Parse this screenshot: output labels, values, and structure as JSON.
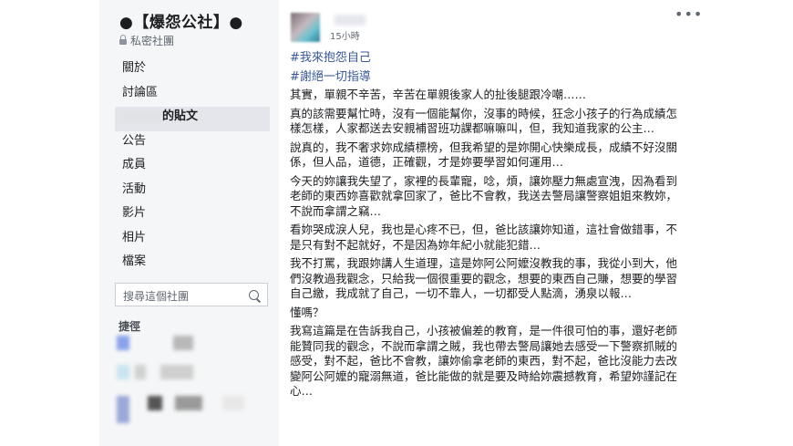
{
  "group": {
    "title": "●【爆怨公社】●",
    "privacy": "私密社團"
  },
  "nav": {
    "items": [
      {
        "label": "關於"
      },
      {
        "label": "討論區"
      },
      {
        "label": "的貼文"
      },
      {
        "label": "公告"
      },
      {
        "label": "成員"
      },
      {
        "label": "活動"
      },
      {
        "label": "影片"
      },
      {
        "label": "相片"
      },
      {
        "label": "檔案"
      }
    ],
    "active_index": 2
  },
  "search": {
    "placeholder": "搜尋這個社團"
  },
  "shortcuts": {
    "label": "捷徑"
  },
  "post": {
    "time": "15小時",
    "more": "•••",
    "hashtags": [
      "#我來抱怨自己",
      "#謝絕一切指導"
    ],
    "paragraphs": [
      "其實，單親不辛苦，辛苦在單親後家人的扯後腿跟冷嘲……",
      "真的該需要幫忙時，沒有一個能幫你，沒事的時候，狂念小孩子的行為成績怎樣怎樣，人家都送去安親補習班功課都嘛嘛叫，但，我知道我家的公主…",
      "說真的，我不奢求妳成績標榜，但我希望的是妳開心快樂成長，成績不好沒關係，但人品，道德，正確觀，才是妳要學習如何運用…",
      "今天的妳讓我失望了，家裡的長輩寵，唸，煩，讓妳壓力無處宣洩，因為看到老師的東西妳喜歡就拿回家了，爸比不會教，我送去警局讓警察姐姐來教妳，不說而拿謂之竊…",
      "看妳哭成淚人兒，我也是心疼不已，但，爸比該讓妳知道，這社會做錯事，不是只有對不起就好，不是因為妳年紀小就能犯錯…",
      "我不打罵，我跟妳講人生道理，這是妳阿公阿嬤沒教我的事，我從小到大，他們沒教過我觀念，只給我一個很重要的觀念，想要的東西自己賺，想要的學習自己繳，我成就了自己，一切不靠人，一切都受人點滴，湧泉以報…",
      "懂嗎？",
      "我寫這篇是在告訴我自己，小孩被偏差的教育，是一件很可怕的事，還好老師能贊同我的觀念，不說而拿謂之賊，我也帶去警局讓她去感受一下警察抓賊的感受，對不起，爸比不會教，讓妳偷拿老師的東西，對不起，爸比沒能力去改變阿公阿嬤的寵溺無道，爸比能做的就是要及時給妳震撼教育，希望妳謹記在心…"
    ]
  },
  "colors": {
    "link": "#385898",
    "frame": "#e9ebee",
    "sidebar": "#f5f6f7"
  }
}
